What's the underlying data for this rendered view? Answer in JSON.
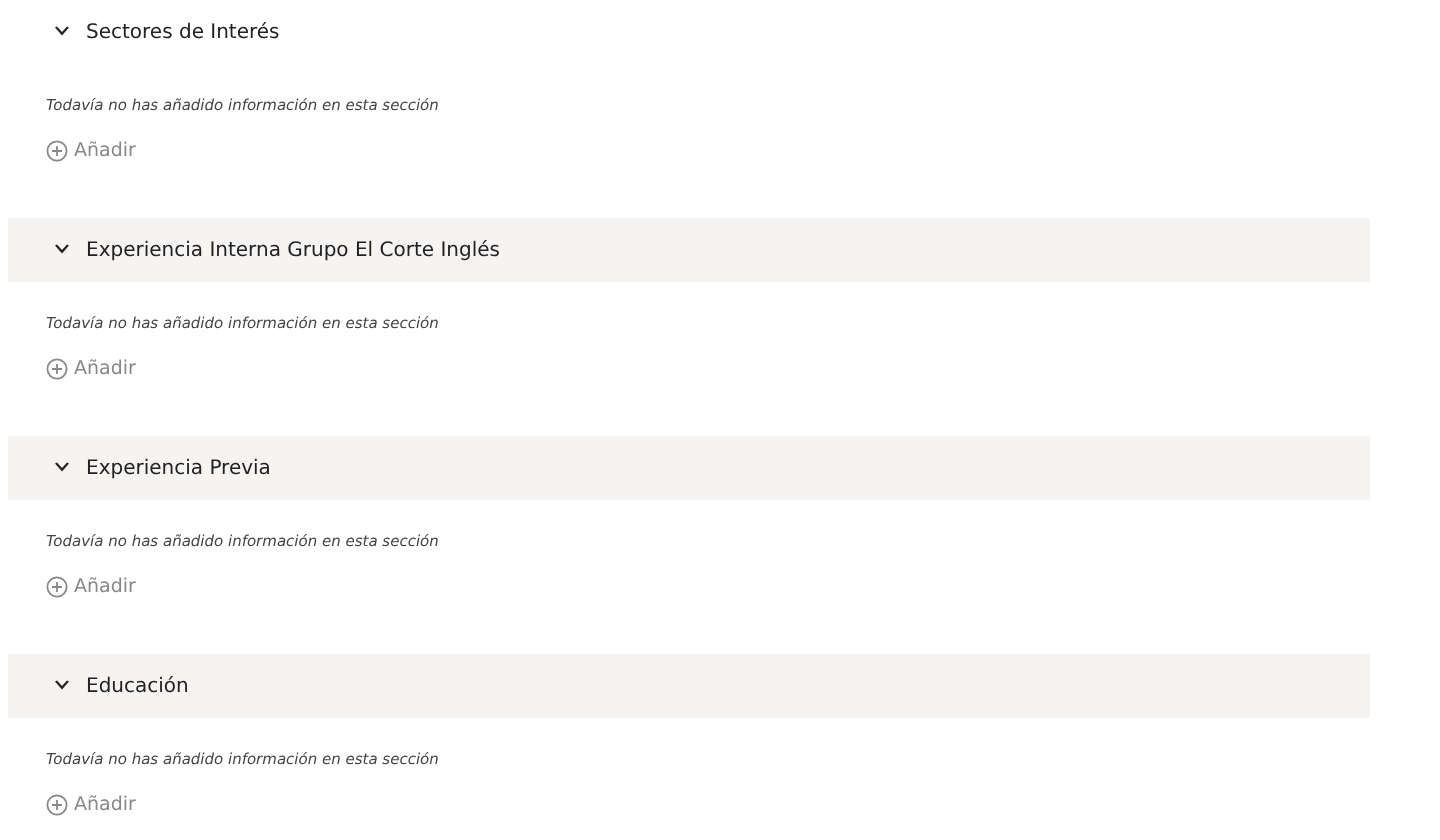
{
  "sections": [
    {
      "title": "Sectores de Interés",
      "expanded": true,
      "shaded": false,
      "empty_text": "Todavía no has añadido información en esta sección",
      "add_label": "Añadir"
    },
    {
      "title": "Experiencia Interna Grupo El Corte Inglés",
      "expanded": true,
      "shaded": true,
      "empty_text": "Todavía no has añadido información en esta sección",
      "add_label": "Añadir"
    },
    {
      "title": "Experiencia Previa",
      "expanded": true,
      "shaded": true,
      "empty_text": "Todavía no has añadido información en esta sección",
      "add_label": "Añadir"
    },
    {
      "title": "Educación",
      "expanded": true,
      "shaded": true,
      "empty_text": "Todavía no has añadido información en esta sección",
      "add_label": "Añadir"
    }
  ]
}
